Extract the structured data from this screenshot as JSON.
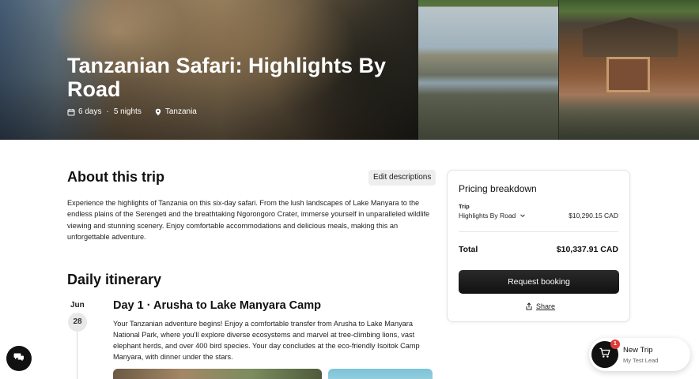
{
  "hero": {
    "title": "Tanzanian Safari: Highlights By Road",
    "days": "6 days",
    "separator": "·",
    "nights": "5 nights",
    "location": "Tanzania"
  },
  "about": {
    "heading": "About this trip",
    "edit_label": "Edit descriptions",
    "description": "Experience the highlights of Tanzania on this six-day safari. From the lush landscapes of Lake Manyara to the endless plains of the Serengeti and the breathtaking Ngorongoro Crater, immerse yourself in unparalleled wildlife viewing and stunning scenery. Enjoy comfortable accommodations and delicious meals, making this an unforgettable adventure."
  },
  "itinerary": {
    "heading": "Daily itinerary",
    "days": [
      {
        "month": "Jun",
        "date": "28",
        "title": "Day 1 · Arusha to Lake Manyara Camp",
        "description": "Your Tanzanian adventure begins! Enjoy a comfortable transfer from Arusha to Lake Manyara National Park, where you'll explore diverse ecosystems and marvel at tree-climbing lions, vast elephant herds, and over 400 bird species. Your day concludes at the eco-friendly Isoitok Camp Manyara, with dinner under the stars."
      }
    ]
  },
  "pricing": {
    "heading": "Pricing breakdown",
    "trip_label": "Trip",
    "trip_name": "Highlights By Road",
    "trip_price": "$10,290.15 CAD",
    "total_label": "Total",
    "total_value": "$10,337.91 CAD",
    "request_label": "Request booking",
    "share_label": "Share"
  },
  "floating": {
    "cart_count": "1",
    "trip_title": "New Trip",
    "trip_subtitle": "My Test Lead"
  },
  "colors": {
    "primary_button": "#111111",
    "badge": "#e03a3a"
  }
}
